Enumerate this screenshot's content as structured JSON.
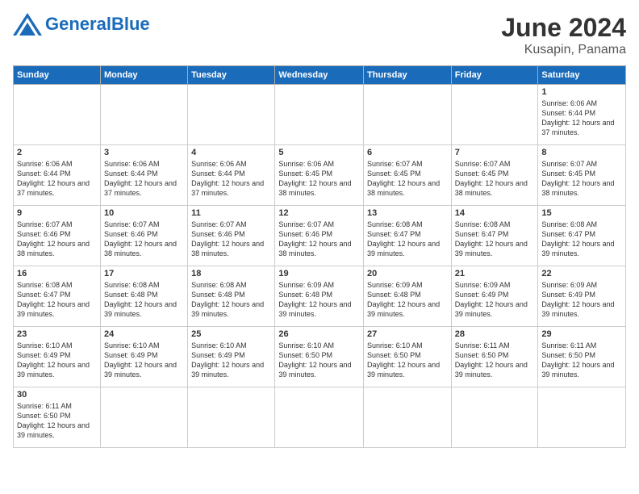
{
  "header": {
    "logo_general": "General",
    "logo_blue": "Blue",
    "title": "June 2024",
    "subtitle": "Kusapin, Panama"
  },
  "days_of_week": [
    "Sunday",
    "Monday",
    "Tuesday",
    "Wednesday",
    "Thursday",
    "Friday",
    "Saturday"
  ],
  "weeks": [
    [
      {
        "day": "",
        "info": ""
      },
      {
        "day": "",
        "info": ""
      },
      {
        "day": "",
        "info": ""
      },
      {
        "day": "",
        "info": ""
      },
      {
        "day": "",
        "info": ""
      },
      {
        "day": "",
        "info": ""
      },
      {
        "day": "1",
        "info": "Sunrise: 6:06 AM\nSunset: 6:44 PM\nDaylight: 12 hours and 37 minutes."
      }
    ],
    [
      {
        "day": "2",
        "info": "Sunrise: 6:06 AM\nSunset: 6:44 PM\nDaylight: 12 hours and 37 minutes."
      },
      {
        "day": "3",
        "info": "Sunrise: 6:06 AM\nSunset: 6:44 PM\nDaylight: 12 hours and 37 minutes."
      },
      {
        "day": "4",
        "info": "Sunrise: 6:06 AM\nSunset: 6:44 PM\nDaylight: 12 hours and 37 minutes."
      },
      {
        "day": "5",
        "info": "Sunrise: 6:06 AM\nSunset: 6:45 PM\nDaylight: 12 hours and 38 minutes."
      },
      {
        "day": "6",
        "info": "Sunrise: 6:07 AM\nSunset: 6:45 PM\nDaylight: 12 hours and 38 minutes."
      },
      {
        "day": "7",
        "info": "Sunrise: 6:07 AM\nSunset: 6:45 PM\nDaylight: 12 hours and 38 minutes."
      },
      {
        "day": "8",
        "info": "Sunrise: 6:07 AM\nSunset: 6:45 PM\nDaylight: 12 hours and 38 minutes."
      }
    ],
    [
      {
        "day": "9",
        "info": "Sunrise: 6:07 AM\nSunset: 6:46 PM\nDaylight: 12 hours and 38 minutes."
      },
      {
        "day": "10",
        "info": "Sunrise: 6:07 AM\nSunset: 6:46 PM\nDaylight: 12 hours and 38 minutes."
      },
      {
        "day": "11",
        "info": "Sunrise: 6:07 AM\nSunset: 6:46 PM\nDaylight: 12 hours and 38 minutes."
      },
      {
        "day": "12",
        "info": "Sunrise: 6:07 AM\nSunset: 6:46 PM\nDaylight: 12 hours and 38 minutes."
      },
      {
        "day": "13",
        "info": "Sunrise: 6:08 AM\nSunset: 6:47 PM\nDaylight: 12 hours and 39 minutes."
      },
      {
        "day": "14",
        "info": "Sunrise: 6:08 AM\nSunset: 6:47 PM\nDaylight: 12 hours and 39 minutes."
      },
      {
        "day": "15",
        "info": "Sunrise: 6:08 AM\nSunset: 6:47 PM\nDaylight: 12 hours and 39 minutes."
      }
    ],
    [
      {
        "day": "16",
        "info": "Sunrise: 6:08 AM\nSunset: 6:47 PM\nDaylight: 12 hours and 39 minutes."
      },
      {
        "day": "17",
        "info": "Sunrise: 6:08 AM\nSunset: 6:48 PM\nDaylight: 12 hours and 39 minutes."
      },
      {
        "day": "18",
        "info": "Sunrise: 6:08 AM\nSunset: 6:48 PM\nDaylight: 12 hours and 39 minutes."
      },
      {
        "day": "19",
        "info": "Sunrise: 6:09 AM\nSunset: 6:48 PM\nDaylight: 12 hours and 39 minutes."
      },
      {
        "day": "20",
        "info": "Sunrise: 6:09 AM\nSunset: 6:48 PM\nDaylight: 12 hours and 39 minutes."
      },
      {
        "day": "21",
        "info": "Sunrise: 6:09 AM\nSunset: 6:49 PM\nDaylight: 12 hours and 39 minutes."
      },
      {
        "day": "22",
        "info": "Sunrise: 6:09 AM\nSunset: 6:49 PM\nDaylight: 12 hours and 39 minutes."
      }
    ],
    [
      {
        "day": "23",
        "info": "Sunrise: 6:10 AM\nSunset: 6:49 PM\nDaylight: 12 hours and 39 minutes."
      },
      {
        "day": "24",
        "info": "Sunrise: 6:10 AM\nSunset: 6:49 PM\nDaylight: 12 hours and 39 minutes."
      },
      {
        "day": "25",
        "info": "Sunrise: 6:10 AM\nSunset: 6:49 PM\nDaylight: 12 hours and 39 minutes."
      },
      {
        "day": "26",
        "info": "Sunrise: 6:10 AM\nSunset: 6:50 PM\nDaylight: 12 hours and 39 minutes."
      },
      {
        "day": "27",
        "info": "Sunrise: 6:10 AM\nSunset: 6:50 PM\nDaylight: 12 hours and 39 minutes."
      },
      {
        "day": "28",
        "info": "Sunrise: 6:11 AM\nSunset: 6:50 PM\nDaylight: 12 hours and 39 minutes."
      },
      {
        "day": "29",
        "info": "Sunrise: 6:11 AM\nSunset: 6:50 PM\nDaylight: 12 hours and 39 minutes."
      }
    ],
    [
      {
        "day": "30",
        "info": "Sunrise: 6:11 AM\nSunset: 6:50 PM\nDaylight: 12 hours and 39 minutes."
      },
      {
        "day": "",
        "info": ""
      },
      {
        "day": "",
        "info": ""
      },
      {
        "day": "",
        "info": ""
      },
      {
        "day": "",
        "info": ""
      },
      {
        "day": "",
        "info": ""
      },
      {
        "day": "",
        "info": ""
      }
    ]
  ]
}
